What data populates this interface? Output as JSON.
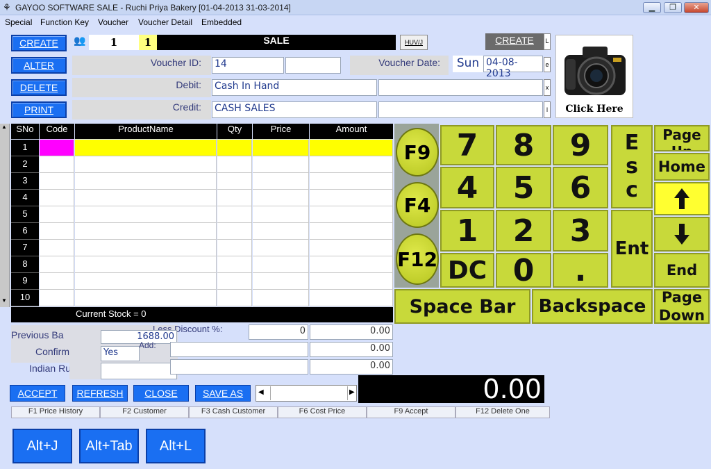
{
  "window": {
    "title": "GAYOO SOFTWARE SALE - Ruchi Priya Bakery [01-04-2013 31-03-2014]"
  },
  "menu": [
    "Special",
    "Function Key",
    "Voucher",
    "Voucher Detail",
    "Embedded"
  ],
  "side_buttons": [
    "CREATE",
    "ALTER",
    "DELETE",
    "PRINT"
  ],
  "header": {
    "left_num": "1",
    "right_num": "1",
    "title": "SALE",
    "small_btn": "HUV/J",
    "create": "CREATE",
    "edge": "L"
  },
  "voucher": {
    "id_label": "Voucher ID:",
    "id_value": "14",
    "date_label": "Voucher Date:",
    "day": "Sun",
    "date": "04-08-2013",
    "edge": "e"
  },
  "debit": {
    "label": "Debit:",
    "value": "Cash In Hand",
    "edge": "x"
  },
  "credit": {
    "label": "Credit:",
    "value": "CASH SALES",
    "edge": "l"
  },
  "camera": {
    "caption": "Click Here"
  },
  "grid": {
    "headers": [
      "SNo",
      "Code",
      "ProductName",
      "Qty",
      "Price",
      "Amount"
    ],
    "rows": [
      "1",
      "2",
      "3",
      "4",
      "5",
      "6",
      "7",
      "8",
      "9",
      "10"
    ],
    "stock": "Current Stock = 0"
  },
  "keypad": {
    "f9": "F9",
    "f4": "F4",
    "f12": "F12",
    "k7": "7",
    "k8": "8",
    "k9": "9",
    "k4": "4",
    "k5": "5",
    "k6": "6",
    "k1": "1",
    "k2": "2",
    "k3": "3",
    "dc": "DC",
    "k0": "0",
    "dot": ".",
    "esc1": "E",
    "esc2": "s",
    "esc3": "c",
    "ent": "Ent",
    "pageup": "Page Up",
    "home": "Home",
    "end": "End",
    "pagedown1": "Page",
    "pagedown2": "Down",
    "space": "Space Bar",
    "backspace": "Backspace"
  },
  "totals": {
    "prev_label": "Previous Ba",
    "prev_value": "1688.00",
    "confirm_label": "Confirm",
    "confirm_value": "Yes",
    "indian_label": "Indian Ru",
    "discount_label": "Less Discount %:",
    "discount_pct": "0",
    "discount_amt": "0.00",
    "add_label": "Add:",
    "add_amt": "0.00",
    "row3_amt": "0.00",
    "total": "0.00"
  },
  "actions": [
    "ACCEPT",
    "REFRESH",
    "CLOSE",
    "SAVE AS"
  ],
  "fkeys": [
    "F1 Price History",
    "F2 Customer",
    "F3 Cash Customer",
    "F6 Cost Price",
    "F9 Accept",
    "F12 Delete One"
  ],
  "alt_buttons": [
    "Alt+J",
    "Alt+Tab",
    "Alt+L"
  ]
}
